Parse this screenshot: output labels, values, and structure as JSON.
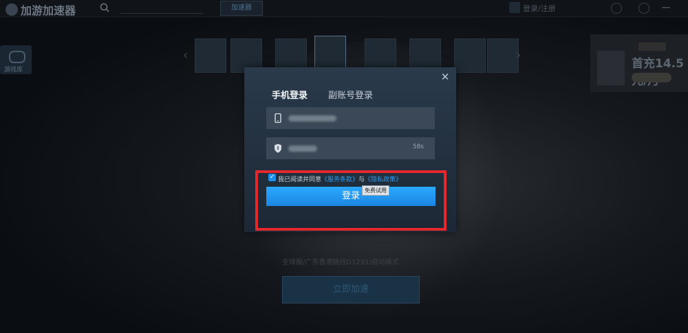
{
  "app": {
    "name": "加游加速器"
  },
  "topbar": {
    "search_button": "加速器",
    "login_status": "登录/注册"
  },
  "sidebar": {
    "game_library_label": "游戏库"
  },
  "ad": {
    "text": "首充14.5元/月"
  },
  "background": {
    "server_info": "全球服/广东香港跳线D1291/自动模式",
    "accelerate_button": "立即加速"
  },
  "dialog": {
    "tabs": {
      "phone_login": "手机登录",
      "sub_account_login": "副账号登录"
    },
    "code_timer": "58s",
    "agreement": {
      "prefix": "我已阅读并同意",
      "terms": "《服务条款》",
      "connector": "与",
      "privacy": "《隐私政策》"
    },
    "tooltip": "免费试用",
    "login_button": "登录"
  },
  "colors": {
    "accent": "#1e8fe8",
    "highlight_border": "#e4282d"
  }
}
